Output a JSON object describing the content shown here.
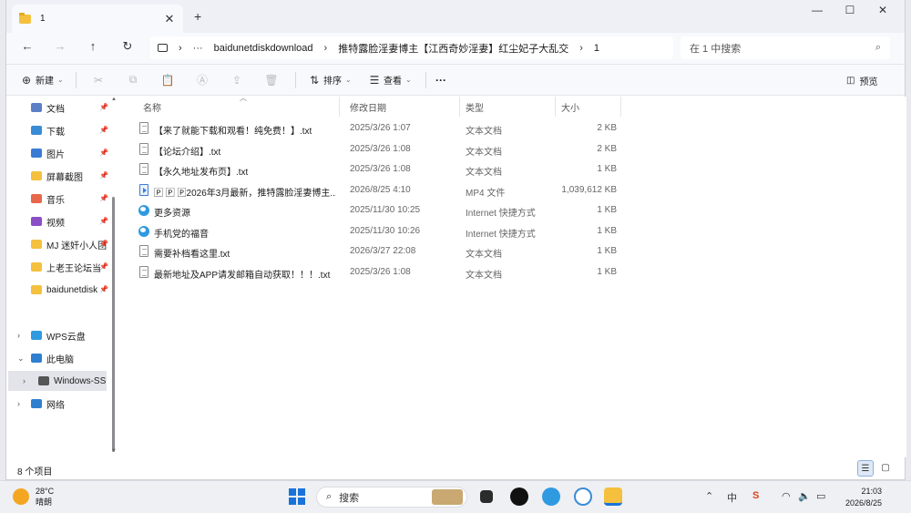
{
  "window": {
    "tab_title": "1",
    "new_tab": "+",
    "minimize": "—",
    "maximize": "☐",
    "close": "✕"
  },
  "nav": {
    "back": "←",
    "forward": "→",
    "up": "↑",
    "refresh": "↻",
    "more": "···",
    "breadcrumb": [
      "baidunetdiskdownload",
      "推特露脸淫妻博主【江西奇妙淫妻】红尘妃子大乱交",
      "1"
    ],
    "search_placeholder": "在 1 中搜索"
  },
  "toolbar": {
    "new_label": "新建",
    "sort_label": "排序",
    "view_label": "查看",
    "more_label": "···",
    "preview_label": "预览"
  },
  "sidebar": {
    "pinned": [
      {
        "label": "文档",
        "icon": "document-icon",
        "color": "#5b7fc7"
      },
      {
        "label": "下载",
        "icon": "download-icon",
        "color": "#3a8bd5"
      },
      {
        "label": "图片",
        "icon": "picture-icon",
        "color": "#3a7bd5"
      },
      {
        "label": "屏幕截图",
        "icon": "folder-icon",
        "color": "#f4c03e"
      },
      {
        "label": "音乐",
        "icon": "music-icon",
        "color": "#e8674a"
      },
      {
        "label": "视频",
        "icon": "video-icon",
        "color": "#8a4fc7"
      },
      {
        "label": "MJ 迷奸小人团",
        "icon": "folder-icon",
        "color": "#f4c03e"
      },
      {
        "label": "上老王论坛当",
        "icon": "folder-icon",
        "color": "#f4c03e"
      },
      {
        "label": "baidunetdisk",
        "icon": "folder-icon",
        "color": "#f4c03e"
      }
    ],
    "tree": [
      {
        "label": "WPS云盘",
        "icon": "cloud-icon",
        "color": "#2f9ae0",
        "chevron": "›"
      },
      {
        "label": "此电脑",
        "icon": "computer-icon",
        "color": "#2f7fd0",
        "chevron": "⌄"
      },
      {
        "label": "Windows-SSD",
        "icon": "drive-icon",
        "color": "#555555",
        "chevron": "›"
      },
      {
        "label": "网络",
        "icon": "network-icon",
        "color": "#2f7fd0",
        "chevron": "›"
      }
    ]
  },
  "columns": {
    "name": "名称",
    "date": "修改日期",
    "type": "类型",
    "size": "大小"
  },
  "files": [
    {
      "name": "【来了就能下载和观看！纯免费！】.txt",
      "date": "2025/3/26 1:07",
      "type": "文本文档",
      "size": "2 KB",
      "kind": "txt"
    },
    {
      "name": "【论坛介绍】.txt",
      "date": "2025/3/26 1:08",
      "type": "文本文档",
      "size": "2 KB",
      "kind": "txt"
    },
    {
      "name": "【永久地址发布页】.txt",
      "date": "2025/3/26 1:08",
      "type": "文本文档",
      "size": "1 KB",
      "kind": "txt"
    },
    {
      "name": "🄿 🄿 🄿2026年3月最新，推特露脸淫妻博主...",
      "date": "2026/8/25 4:10",
      "type": "MP4 文件",
      "size": "1,039,612 KB",
      "kind": "mp4"
    },
    {
      "name": "更多资源",
      "date": "2025/11/30 10:25",
      "type": "Internet 快捷方式",
      "size": "1 KB",
      "kind": "url"
    },
    {
      "name": "手机党的福音",
      "date": "2025/11/30 10:26",
      "type": "Internet 快捷方式",
      "size": "1 KB",
      "kind": "url"
    },
    {
      "name": "需要补档看这里.txt",
      "date": "2026/3/27 22:08",
      "type": "文本文档",
      "size": "1 KB",
      "kind": "txt"
    },
    {
      "name": "最新地址及APP请发邮箱自动获取！！！.txt",
      "date": "2025/3/26 1:08",
      "type": "文本文档",
      "size": "1 KB",
      "kind": "txt"
    }
  ],
  "status": {
    "count": "8 个项目"
  },
  "taskbar": {
    "temp": "28°C",
    "weather": "晴朗",
    "search": "搜索",
    "time": "21:03",
    "date": "2026/8/25",
    "ime": "中"
  }
}
